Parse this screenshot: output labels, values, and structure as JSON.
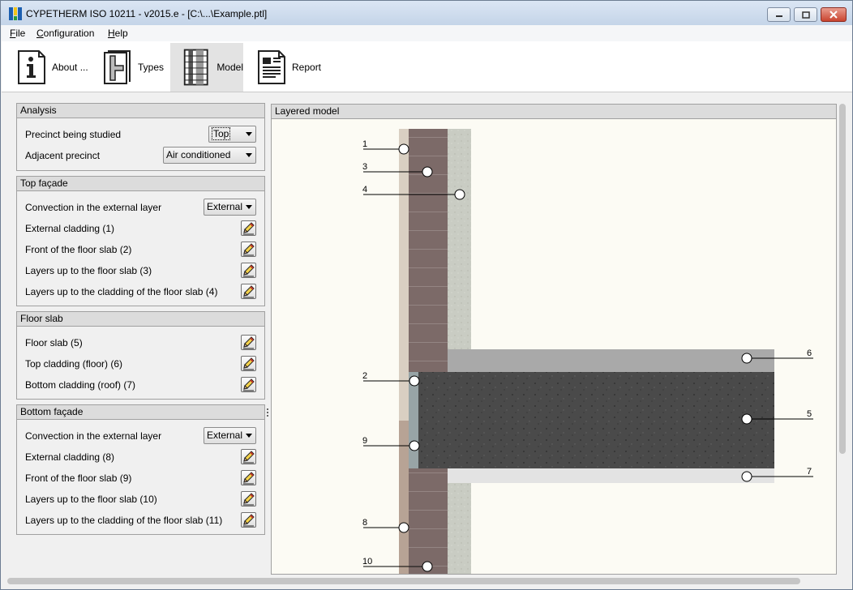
{
  "window": {
    "title": "CYPETHERM ISO 10211 - v2015.e - [C:\\...\\Example.ptl]"
  },
  "menu": {
    "file": {
      "ul": "F",
      "rest": "ile"
    },
    "configuration": {
      "ul": "C",
      "rest": "onfiguration"
    },
    "help": {
      "ul": "H",
      "rest": "elp"
    }
  },
  "toolbar": {
    "about": "About ...",
    "types": "Types",
    "model": "Model",
    "report": "Report",
    "active": "model"
  },
  "analysis": {
    "header": "Analysis",
    "precinct_label": "Precinct being studied",
    "precinct_value": "Top",
    "adjacent_label": "Adjacent precinct",
    "adjacent_value": "Air conditioned"
  },
  "top_facade": {
    "header": "Top façade",
    "convection_label": "Convection in the external layer",
    "convection_value": "External",
    "items": [
      "External cladding (1)",
      "Front of the floor slab (2)",
      "Layers up to the floor slab (3)",
      "Layers up to the cladding of the floor slab (4)"
    ]
  },
  "floor_slab": {
    "header": "Floor slab",
    "items": [
      "Floor slab (5)",
      "Top cladding (floor) (6)",
      "Bottom cladding (roof) (7)"
    ]
  },
  "bottom_facade": {
    "header": "Bottom façade",
    "convection_label": "Convection in the external layer",
    "convection_value": "External",
    "items": [
      "External cladding (8)",
      "Front of the floor slab (9)",
      "Layers up to the floor slab (10)",
      "Layers up to the cladding of the floor slab (11)"
    ]
  },
  "model_view": {
    "header": "Layered model",
    "callouts": [
      "1",
      "3",
      "4",
      "6",
      "2",
      "5",
      "9",
      "7",
      "8",
      "10"
    ]
  },
  "colors": {
    "plaster": "#d9cfc2",
    "brick": "#7c6a68",
    "insulation": "#c9ccc3",
    "slab": "#4a4a4a",
    "floor_cladding": "#a9a9a9",
    "roof_cladding": "#e3e3e3",
    "canvas_bg": "#fcfbf4"
  }
}
